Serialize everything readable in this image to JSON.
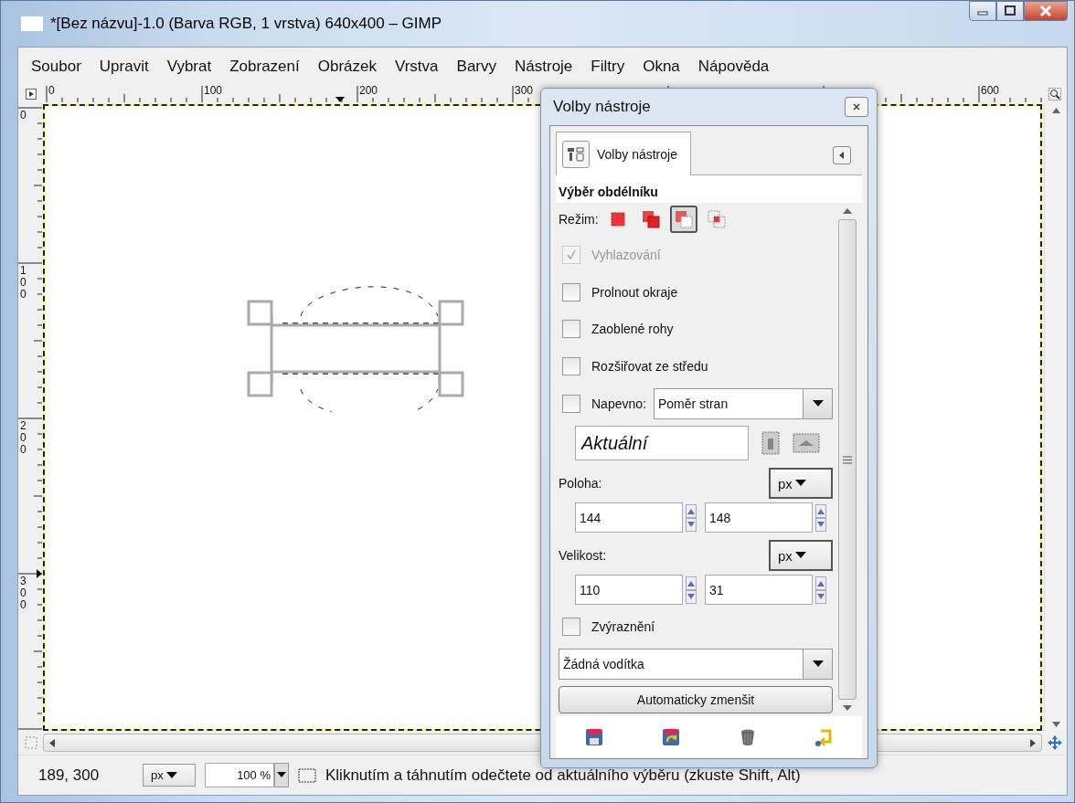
{
  "window": {
    "title": "*[Bez názvu]-1.0 (Barva RGB, 1 vrstva) 640x400 – GIMP"
  },
  "menu": [
    "Soubor",
    "Upravit",
    "Vybrat",
    "Zobrazení",
    "Obrázek",
    "Vrstva",
    "Barvy",
    "Nástroje",
    "Filtry",
    "Okna",
    "Nápověda"
  ],
  "rulers": {
    "horizontal": [
      "0",
      "100",
      "200",
      "300",
      "600"
    ],
    "vertical": [
      "0",
      "100",
      "200",
      "300"
    ]
  },
  "tool_options": {
    "title": "Volby nástroje",
    "tabs": [
      {
        "label": "Volby nástroje",
        "selected": true
      }
    ],
    "heading": "Výběr obdélníku",
    "mode": {
      "label": "Režim:",
      "options": [
        {
          "kind": "replace",
          "selected": false
        },
        {
          "kind": "add",
          "selected": false
        },
        {
          "kind": "subtract",
          "selected": true
        },
        {
          "kind": "intersect",
          "selected": false
        }
      ]
    },
    "options": [
      {
        "kind": "checkbox",
        "label": "Vyhlazování",
        "checked": true,
        "disabled": true
      },
      {
        "kind": "checkbox",
        "label": "Prolnout okraje",
        "checked": false,
        "disabled": false
      },
      {
        "kind": "checkbox",
        "label": "Zaoblené rohy",
        "checked": false,
        "disabled": false
      },
      {
        "kind": "checkbox",
        "label": "Rozšiřovat ze středu",
        "checked": false,
        "disabled": false
      },
      {
        "kind": "fixed",
        "label": "Napevno:",
        "checked": false,
        "disabled": false,
        "value": "Poměr stran"
      },
      {
        "kind": "preset",
        "value": "Aktuální"
      },
      {
        "kind": "coords",
        "label": "Poloha:",
        "unit": "px",
        "values": [
          "144",
          "148"
        ]
      },
      {
        "kind": "coords",
        "label": "Velikost:",
        "unit": "px",
        "values": [
          "110",
          "31"
        ]
      },
      {
        "kind": "checkbox",
        "label": "Zvýraznění",
        "checked": false,
        "disabled": false
      },
      {
        "kind": "combo",
        "value": "Žádná vodítka"
      },
      {
        "kind": "button",
        "label": "Automaticky zmenšit"
      }
    ]
  },
  "status_bar": {
    "coords": "189, 300",
    "unit": "px",
    "zoom": "100 %",
    "message": "Kliknutím a táhnutím odečtete od aktuálního výběru (zkuste Shift, Alt)"
  }
}
